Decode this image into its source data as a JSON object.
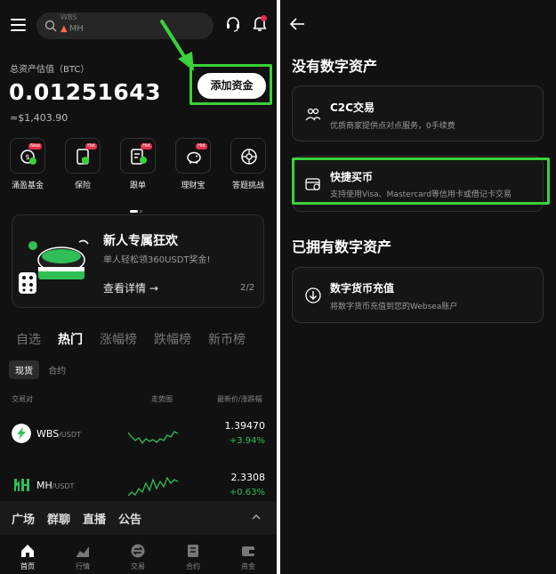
{
  "colors": {
    "bg": "#111111",
    "highlight": "#3ad13a",
    "positive": "#2fbf56",
    "badge": "#e5304a"
  },
  "left": {
    "search": {
      "line1": "WBS",
      "line2": "MH",
      "icon": "search-icon"
    },
    "asset": {
      "label": "总资产估值（BTC）",
      "value": "0.01251643",
      "usd": "≈$1,403.90"
    },
    "add_funds": "添加资金",
    "quick": [
      {
        "label": "涌盈基金",
        "tag": "New",
        "icon": "fund-icon"
      },
      {
        "label": "保险",
        "tag": "Hot",
        "icon": "insurance-icon"
      },
      {
        "label": "跟单",
        "tag": "Hot",
        "icon": "copy-trade-icon"
      },
      {
        "label": "理财宝",
        "tag": "Hot",
        "icon": "piggy-bank-icon"
      },
      {
        "label": "答题挑战",
        "tag": "",
        "icon": "quiz-icon"
      }
    ],
    "banner": {
      "title": "新人专属狂欢",
      "subtitle": "单人轻松领360USDT奖金!",
      "link": "查看详情 →",
      "page": "2/2"
    },
    "market_tabs": [
      "自选",
      "热门",
      "涨幅榜",
      "跌幅榜",
      "新币榜"
    ],
    "active_market_tab": "热门",
    "sub_tabs": [
      "现货",
      "合约"
    ],
    "table_headers": {
      "pair": "交易对",
      "trend": "走势图",
      "price": "最新价/涨跌幅"
    },
    "rows": [
      {
        "base": "WBS",
        "quote": "/USDT",
        "price": "1.39470",
        "change": "+3.94%"
      },
      {
        "base": "MH",
        "quote": "/USDT",
        "price": "2.3308",
        "change": "+0.63%"
      }
    ],
    "community": [
      "广场",
      "群聊",
      "直播",
      "公告"
    ],
    "nav": [
      {
        "label": "首页",
        "icon": "home-icon"
      },
      {
        "label": "行情",
        "icon": "chart-icon"
      },
      {
        "label": "交易",
        "icon": "trade-icon"
      },
      {
        "label": "合约",
        "icon": "contract-icon"
      },
      {
        "label": "资金",
        "icon": "wallet-icon"
      }
    ]
  },
  "right": {
    "section1": "没有数字资产",
    "c2c": {
      "title": "C2C交易",
      "subtitle": "优质商家提供点对点服务，0手续费"
    },
    "quick_buy": {
      "title": "快捷买币",
      "subtitle": "支持使用Visa、Mastercard等信用卡或借记卡交易"
    },
    "section2": "已拥有数字资产",
    "deposit": {
      "title": "数字货币充值",
      "subtitle": "将数字货币充值到您的Websea账户"
    }
  }
}
